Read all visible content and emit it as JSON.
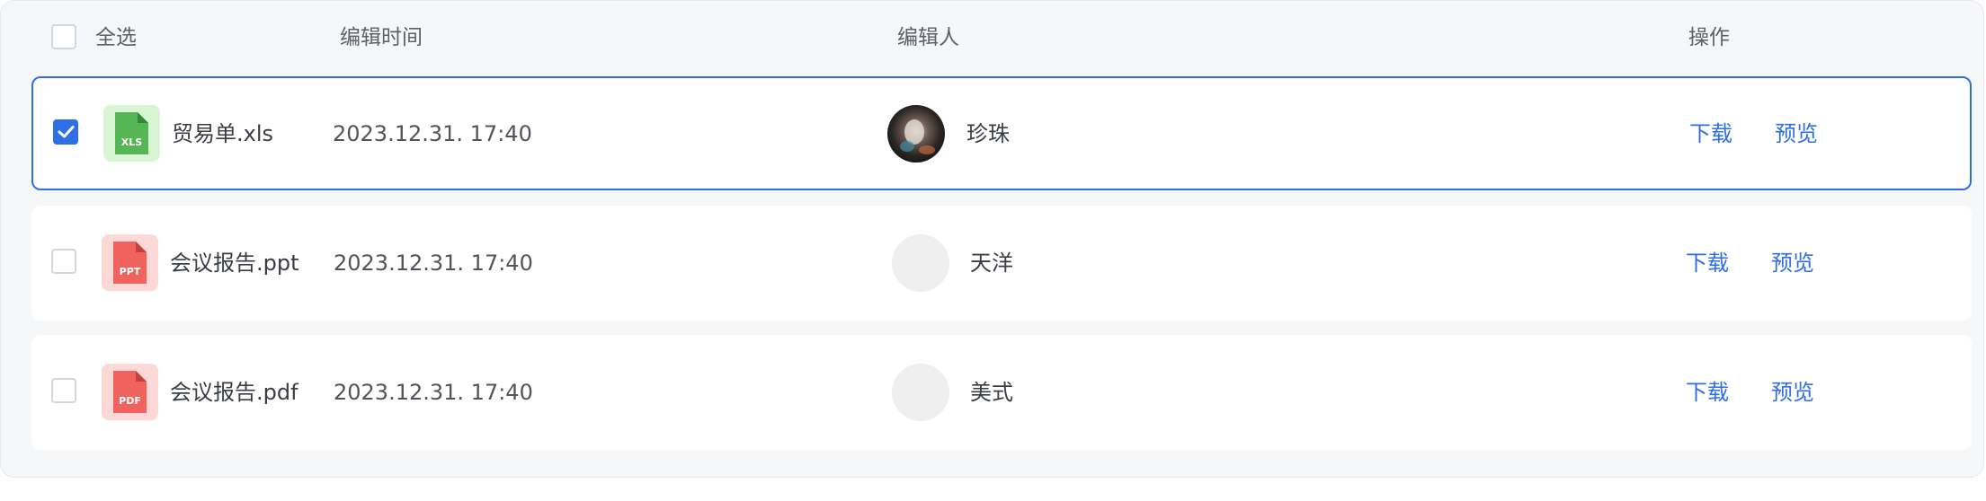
{
  "colors": {
    "accent": "#2f6fe6",
    "xls_icon_bg": "#d8f5d4",
    "xls_icon": "#56b656",
    "ppt_icon_bg": "#fcd8d6",
    "ppt_icon": "#f0625e",
    "pdf_icon_bg": "#fcd8d6",
    "pdf_icon": "#f0625e"
  },
  "header": {
    "select_all_label": "全选",
    "col_time": "编辑时间",
    "col_editor": "编辑人",
    "col_actions": "操作"
  },
  "rows": [
    {
      "filename": "贸易单.xls",
      "file_type": "XLS",
      "edit_time": "2023.12.31. 17:40",
      "editor": "珍珠",
      "download_label": "下载",
      "preview_label": "预览",
      "selected": true
    },
    {
      "filename": "会议报告.ppt",
      "file_type": "PPT",
      "edit_time": "2023.12.31. 17:40",
      "editor": "天洋",
      "download_label": "下载",
      "preview_label": "预览",
      "selected": false
    },
    {
      "filename": "会议报告.pdf",
      "file_type": "PDF",
      "edit_time": "2023.12.31. 17:40",
      "editor": "美式",
      "download_label": "下载",
      "preview_label": "预览",
      "selected": false
    }
  ]
}
